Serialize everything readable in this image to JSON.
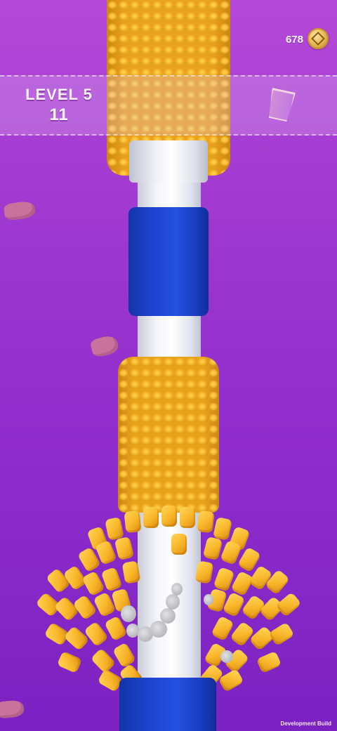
{
  "hud": {
    "level_title": "LEVEL 5",
    "level_count": "11",
    "coins": "678",
    "coin_icon": "coin-icon",
    "cup_icon": "cup-icon"
  },
  "footer": {
    "build_label": "Development Build"
  },
  "colors": {
    "background": "#9b36cf",
    "corn": "#f5b228",
    "ring_blue": "#1e46d4",
    "pole": "#f4f5fa"
  }
}
